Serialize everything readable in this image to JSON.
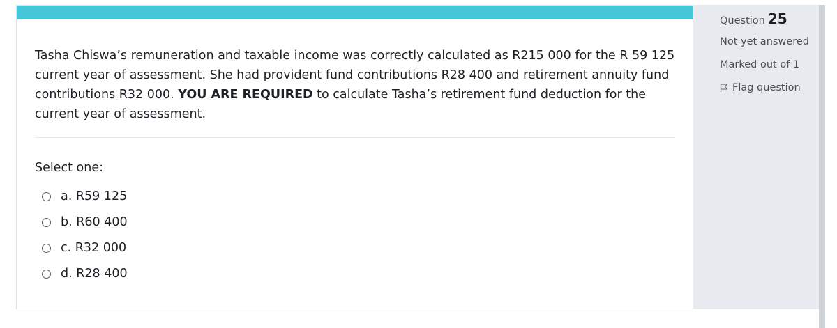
{
  "question": {
    "text_part1": "Tasha Chiswa’s remuneration and taxable income was correctly calculated as R215 000 for the R 59 125 current year of assessment.  She had provident fund contributions R28 400 and retirement annuity fund contributions R32 000. ",
    "text_bold": "YOU ARE REQUIRED",
    "text_part2": " to calculate Tasha’s retirement fund deduction for the current year of assessment.",
    "select_prompt": "Select one:",
    "options": [
      {
        "letter": "a.",
        "value": "R59 125"
      },
      {
        "letter": "b.",
        "value": "R60 400"
      },
      {
        "letter": "c.",
        "value": "R32 000"
      },
      {
        "letter": "d.",
        "value": "R28 400"
      }
    ]
  },
  "info": {
    "question_label": "Question",
    "question_number": "25",
    "status": "Not yet answered",
    "marks": "Marked out of 1",
    "flag_label": "Flag question",
    "flag_icon": "flag-icon"
  },
  "colors": {
    "accent_bar": "#44c8d9",
    "sidebar_bg": "#e7eaee"
  }
}
